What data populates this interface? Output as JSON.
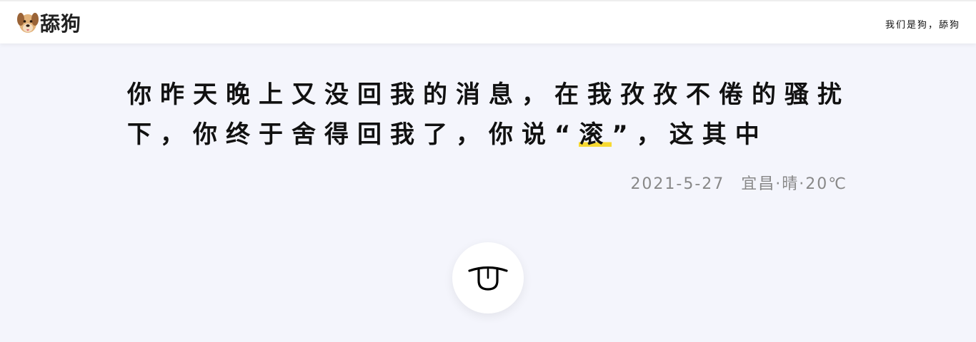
{
  "header": {
    "brand_name": "舔狗",
    "logo_icon": "dog-face-icon",
    "slogan": "我们是狗，舔狗"
  },
  "quote": {
    "text_before": "你昨天晚上又没回我的消息，在我孜孜不倦的骚扰下，你终于舍得回我了，你说“",
    "highlight": "滚",
    "text_after": "”，这其中",
    "highlight_color": "#f7d932"
  },
  "meta": {
    "date": "2021-5-27",
    "location_weather": "宜昌·晴·20℃"
  },
  "action": {
    "icon": "tongue-out-icon"
  }
}
